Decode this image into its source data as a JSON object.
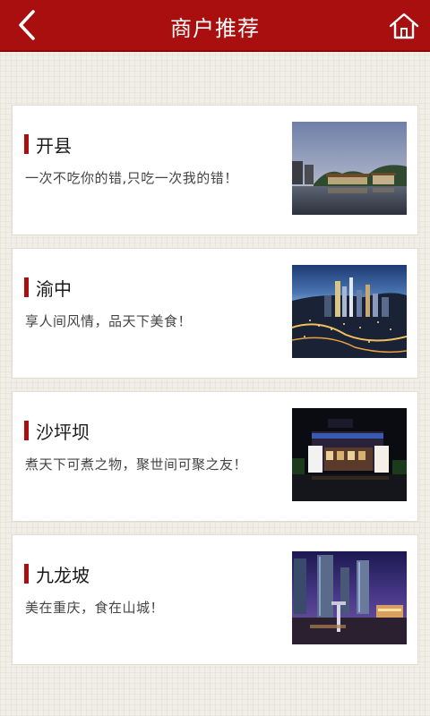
{
  "header": {
    "title": "商户推荐",
    "back_icon": "chevron-left-icon",
    "home_icon": "home-icon",
    "color": "#a90f0f"
  },
  "merchants": [
    {
      "name": "开县",
      "slogan": "一次不吃你的错,只吃一次我的错！",
      "image": "lakeside-pavilion-photo"
    },
    {
      "name": "渝中",
      "slogan": "享人间风情，品天下美食！",
      "image": "city-night-aerial-photo"
    },
    {
      "name": "沙坪坝",
      "slogan": "煮天下可煮之物，聚世间可聚之友！",
      "image": "mall-night-photo"
    },
    {
      "name": "九龙坡",
      "slogan": "美在重庆，食在山城！",
      "image": "skyscraper-dusk-photo"
    }
  ]
}
